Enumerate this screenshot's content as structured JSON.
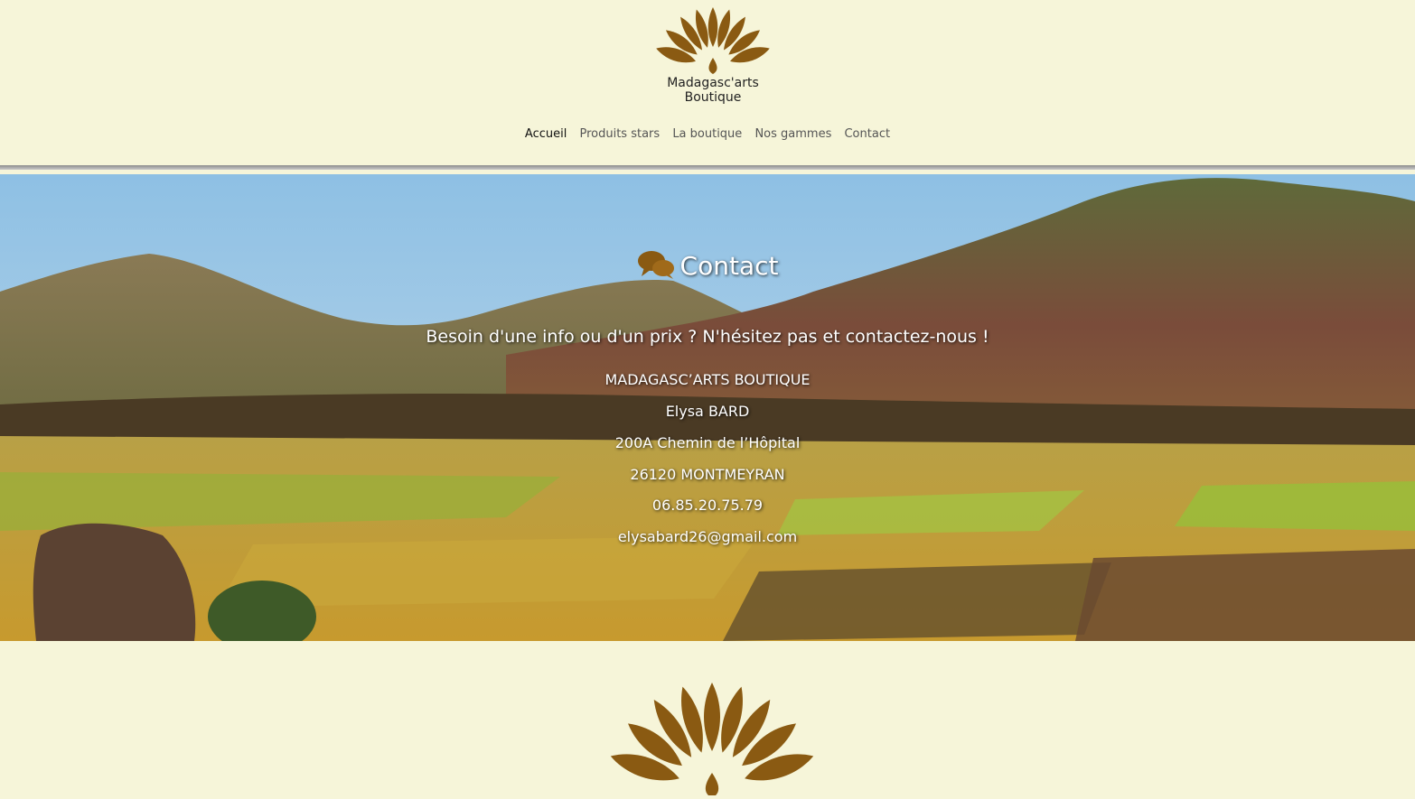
{
  "brand": {
    "line1": "Madagasc'arts",
    "line2": "Boutique",
    "logo_icon": "flower-logo-icon",
    "logo_color": "#8a5a12"
  },
  "nav": {
    "items": [
      {
        "label": "Accueil",
        "active": true
      },
      {
        "label": "Produits stars",
        "active": false
      },
      {
        "label": "La boutique",
        "active": false
      },
      {
        "label": "Nos gammes",
        "active": false
      },
      {
        "label": "Contact",
        "active": false
      }
    ]
  },
  "hero": {
    "title": "Contact",
    "title_icon": "speech-bubbles-icon",
    "tagline": "Besoin d'une info ou d'un prix ? N'hésitez pas et contactez-nous !",
    "company": "MADAGASC’ARTS BOUTIQUE",
    "person": "Elysa BARD",
    "street": "200A Chemin de l’Hôpital",
    "city": "26120 MONTMEYRAN",
    "phone": "06.85.20.75.79",
    "email": "elysabard26@gmail.com"
  },
  "colors": {
    "page_bg": "#f6f5d9",
    "accent_brown": "#8a5a12"
  }
}
